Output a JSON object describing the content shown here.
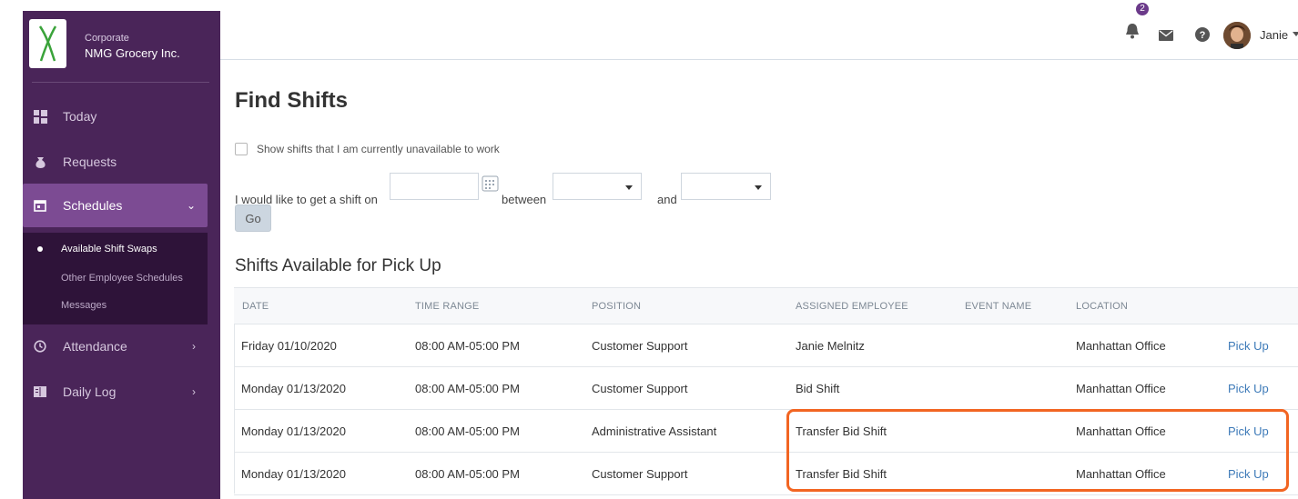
{
  "brand": {
    "subtitle": "Corporate",
    "name": "NMG Grocery Inc."
  },
  "sidebar": {
    "items": [
      {
        "label": "Today",
        "icon": "grid-icon"
      },
      {
        "label": "Requests",
        "icon": "money-bag-icon"
      },
      {
        "label": "Schedules",
        "icon": "calendar-icon",
        "active": true
      },
      {
        "label": "Attendance",
        "icon": "clock-icon"
      },
      {
        "label": "Daily Log",
        "icon": "book-icon"
      }
    ],
    "subitems": [
      {
        "label": "Available Shift Swaps",
        "active": true
      },
      {
        "label": "Other Employee Schedules"
      },
      {
        "label": "Messages"
      }
    ]
  },
  "topbar": {
    "notification_count": "2",
    "user_name": "Janie"
  },
  "page": {
    "title": "Find Shifts",
    "unavailable_checkbox_label": "Show shifts that I am currently unavailable to work",
    "filter_prefix": "I would like to get a shift on",
    "between_label": "between",
    "and_label": "and",
    "go_label": "Go",
    "section_title": "Shifts Available for Pick Up"
  },
  "table": {
    "headers": [
      "DATE",
      "TIME RANGE",
      "POSITION",
      "ASSIGNED EMPLOYEE",
      "EVENT NAME",
      "LOCATION"
    ],
    "rows": [
      {
        "date": "Friday 01/10/2020",
        "time": "08:00 AM-05:00 PM",
        "position": "Customer Support",
        "employee": "Janie Melnitz",
        "event": "",
        "location": "Manhattan Office",
        "action": "Pick Up"
      },
      {
        "date": "Monday 01/13/2020",
        "time": "08:00 AM-05:00 PM",
        "position": "Customer Support",
        "employee": "Bid Shift",
        "event": "",
        "location": "Manhattan Office",
        "action": "Pick Up"
      },
      {
        "date": "Monday 01/13/2020",
        "time": "08:00 AM-05:00 PM",
        "position": "Administrative Assistant",
        "employee": "Transfer Bid Shift",
        "event": "",
        "location": "Manhattan Office",
        "action": "Pick Up"
      },
      {
        "date": "Monday 01/13/2020",
        "time": "08:00 AM-05:00 PM",
        "position": "Customer Support",
        "employee": "Transfer Bid Shift",
        "event": "",
        "location": "Manhattan Office",
        "action": "Pick Up"
      }
    ]
  },
  "colors": {
    "sidebar_bg": "#4a2559",
    "sidebar_active": "#7c4b93",
    "link": "#3d7ab8",
    "highlight": "#f26522"
  }
}
